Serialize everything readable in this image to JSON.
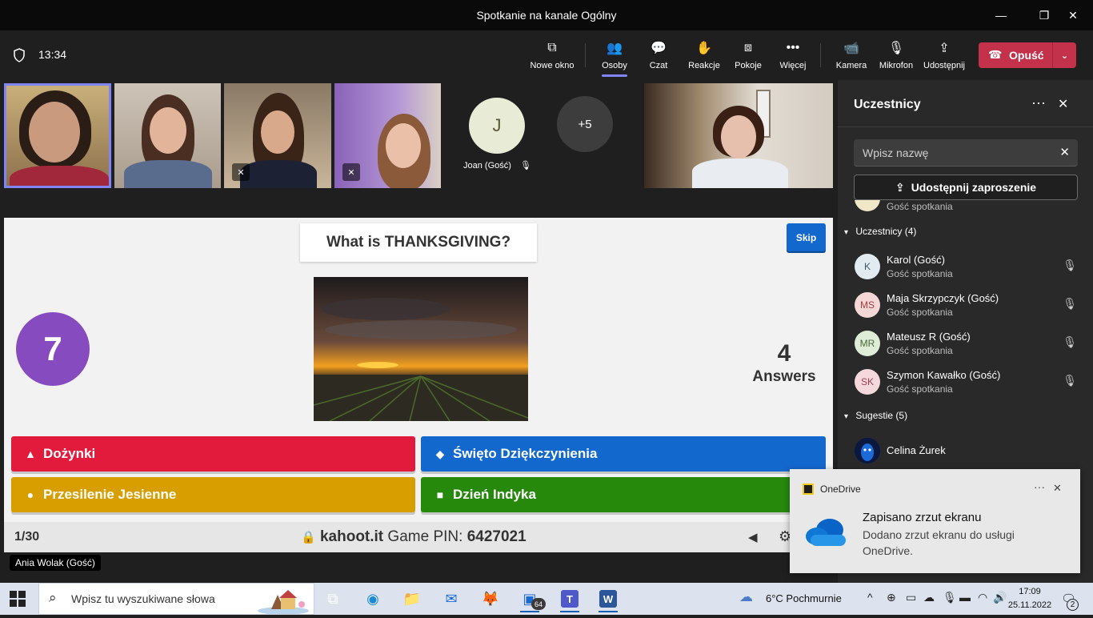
{
  "window": {
    "title": "Spotkanie na kanale Ogólny",
    "minimize": "—",
    "maximize": "❐",
    "close": "✕"
  },
  "toolbar": {
    "time": "13:34",
    "buttons": [
      {
        "label": "Nowe okno",
        "icon": "pop-out-icon",
        "glyph": "⧉"
      },
      {
        "label": "Osoby",
        "icon": "people-icon",
        "glyph": "👥"
      },
      {
        "label": "Czat",
        "icon": "chat-icon",
        "glyph": "💬"
      },
      {
        "label": "Reakcje",
        "icon": "hand-icon",
        "glyph": "✋"
      },
      {
        "label": "Pokoje",
        "icon": "rooms-icon",
        "glyph": "⧈"
      },
      {
        "label": "Więcej",
        "icon": "more-icon",
        "glyph": "•••"
      },
      {
        "label": "Kamera",
        "icon": "camera-icon",
        "glyph": "📹"
      },
      {
        "label": "Mikrofon",
        "icon": "mic-off-icon",
        "glyph": "🎙"
      },
      {
        "label": "Udostępnij",
        "icon": "share-icon",
        "glyph": "⇪"
      }
    ],
    "leave": {
      "label": "Opuść",
      "icon": "phone-hangup-icon",
      "glyph": "☎",
      "chevron": "⌄"
    }
  },
  "tiles": {
    "joan": {
      "initial": "J",
      "name": "Joan (Gość)"
    },
    "overflow": "+5"
  },
  "kahoot": {
    "question": "What is THANKSGIVING?",
    "skip": "Skip",
    "timer": "7",
    "answers_count": "4",
    "answers_label": "Answers",
    "options": [
      {
        "label": "Dożynki",
        "shape": "▲",
        "color": "#e21b3c"
      },
      {
        "label": "Święto Dziękczynienia",
        "shape": "◆",
        "color": "#1368ce"
      },
      {
        "label": "Przesilenie Jesienne",
        "shape": "●",
        "color": "#d89e00"
      },
      {
        "label": "Dzień Indyka",
        "shape": "■",
        "color": "#26890c"
      }
    ],
    "counter": "1/30",
    "site": "kahoot.it",
    "pin_label": "Game PIN:",
    "pin": "6427021",
    "lock_glyph": "🔒",
    "speaker_glyph": "◀",
    "gear_glyph": "⚙"
  },
  "presenter_label": "Ania Wolak (Gość)",
  "panel": {
    "title": "Uczestnicy",
    "more": "···",
    "close": "✕",
    "search_placeholder": "Wpisz nazwę",
    "search_clear": "✕",
    "share_invite": "Udostępnij zaproszenie",
    "share_glyph": "⇪",
    "partial_sub": "Gość spotkania",
    "section_attendees": "Uczestnicy (4)",
    "section_suggestions": "Sugestie (5)",
    "section_caret": "▾",
    "attendees": [
      {
        "initials": "K",
        "name": "Karol (Gość)",
        "sub": "Gość spotkania",
        "bg": "#e1ebf0",
        "fg": "#3a5a6a"
      },
      {
        "initials": "MS",
        "name": "Maja Skrzypczyk (Gość)",
        "sub": "Gość spotkania",
        "bg": "#f4d8d8",
        "fg": "#a04040"
      },
      {
        "initials": "MR",
        "name": "Mateusz R (Gość)",
        "sub": "Gość spotkania",
        "bg": "#dfecd8",
        "fg": "#4a6a3a"
      },
      {
        "initials": "SK",
        "name": "Szymon Kawałko (Gość)",
        "sub": "Gość spotkania",
        "bg": "#f4d8dc",
        "fg": "#a04050"
      }
    ],
    "suggestion": {
      "name": "Celina Żurek"
    },
    "mic_glyph": "🎙"
  },
  "toast": {
    "app": "OneDrive",
    "title": "Zapisano zrzut ekranu",
    "body": "Dodano zrzut ekranu do usługi OneDrive.",
    "more": "···",
    "close": "✕"
  },
  "taskbar": {
    "search_placeholder": "Wpisz tu wyszukiwane słowa",
    "search_glyph": "⌕",
    "apps": [
      {
        "name": "task-view-icon",
        "glyph": "⧉"
      },
      {
        "name": "edge-icon",
        "glyph": "◉"
      },
      {
        "name": "file-explorer-icon",
        "glyph": "📁"
      },
      {
        "name": "mail-icon",
        "glyph": "✉"
      },
      {
        "name": "firefox-icon",
        "glyph": "🦊"
      },
      {
        "name": "app-64-icon",
        "glyph": "▣"
      },
      {
        "name": "teams-icon",
        "glyph": "T"
      },
      {
        "name": "word-icon",
        "glyph": "W"
      }
    ],
    "badge": "64",
    "weather": "6°C  Pochmurnie",
    "weather_glyph": "☁",
    "tray": [
      "^",
      "⊕",
      "▭",
      "☁",
      "🎙",
      "▬",
      "◠",
      "🔊"
    ],
    "time": "17:09",
    "date": "25.11.2022",
    "notif_glyph": "🗨",
    "notif_count": "2"
  }
}
